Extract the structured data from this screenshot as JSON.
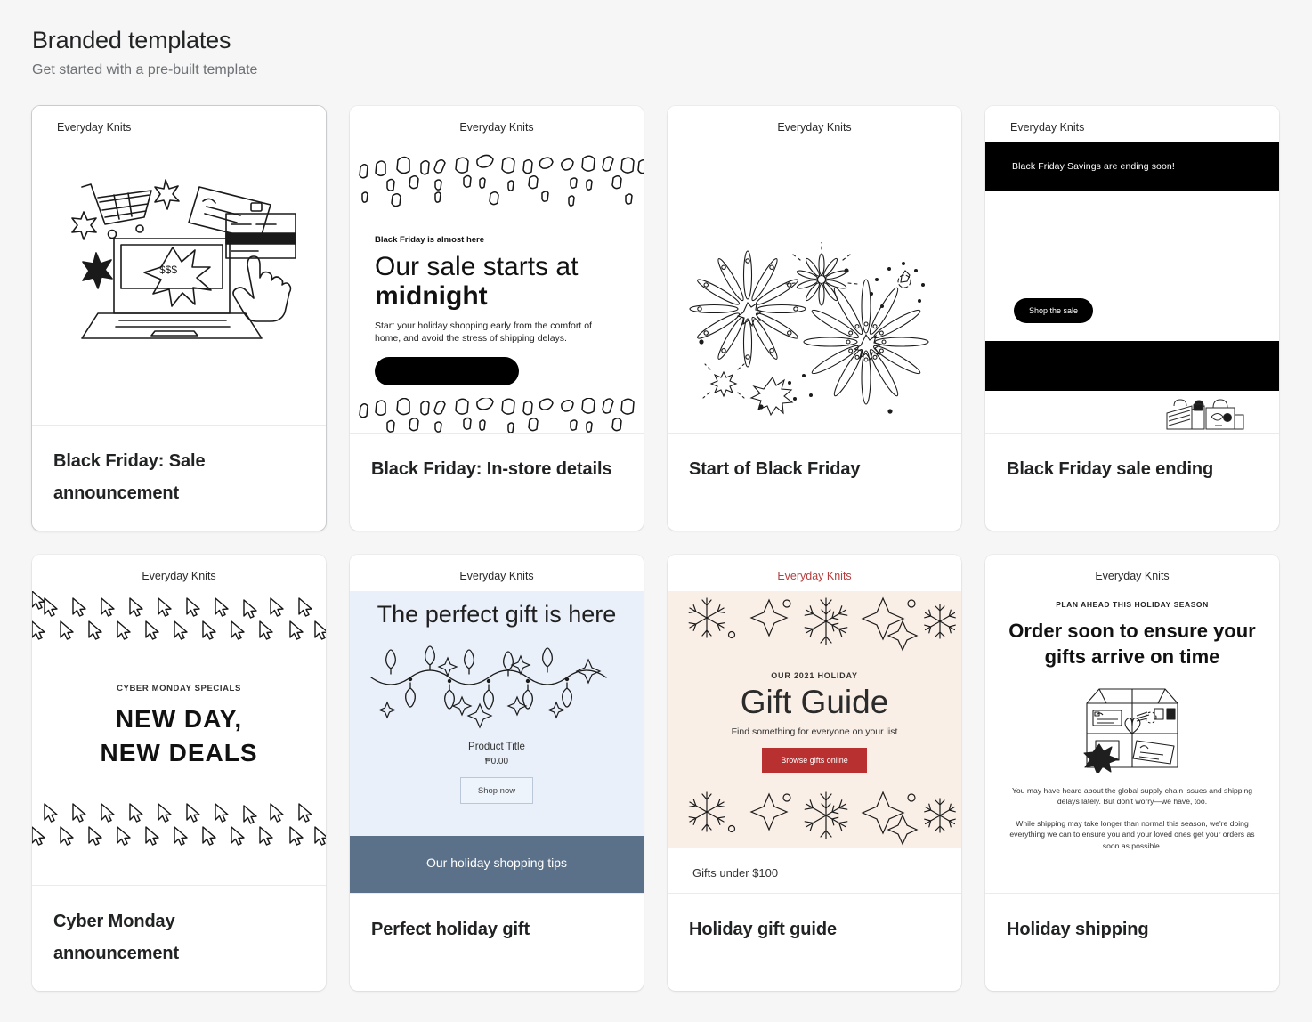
{
  "header": {
    "title": "Branded templates",
    "subtitle": "Get started with a pre-built template"
  },
  "brand_name": "Everyday Knits",
  "accent_colors": {
    "page_background": "#f6f6f6",
    "card_background": "#ffffff",
    "title_text": "#202223",
    "subtitle_text": "#6d7175",
    "gift_guide_cream": "#faefe7",
    "gift_guide_red": "#b93030",
    "gift_guide_brand_red": "#b34040",
    "perfect_gift_blue": "#e9f0fa",
    "perfect_gift_slate": "#5b7189",
    "black": "#000000"
  },
  "cards": [
    {
      "id": "black-friday-sale-announcement",
      "brand": "Everyday Knits",
      "title": "Black Friday: Sale announcement",
      "illustration": "laptop-shopping-illustration",
      "selected": true
    },
    {
      "id": "black-friday-in-store-details",
      "brand": "Everyday Knits",
      "title": "Black Friday: In-store details",
      "eyebrow": "Black Friday is almost here",
      "heading_line1": "Our sale starts at",
      "heading_line2": "midnight",
      "body": "Start your holiday shopping early from the comfort of home, and avoid the stress of shipping delays.",
      "button_label": "",
      "illustration": "confetti-border"
    },
    {
      "id": "start-of-black-friday",
      "brand": "Everyday Knits",
      "title": "Start of Black Friday",
      "illustration": "fireworks-illustration"
    },
    {
      "id": "black-friday-sale-ending",
      "brand": "Everyday Knits",
      "title": "Black Friday sale ending",
      "banner": "Black Friday Savings are ending soon!",
      "button_label": "Shop the sale",
      "illustration": "shopping-bags-illustration"
    },
    {
      "id": "cyber-monday-announcement",
      "brand": "Everyday Knits",
      "title": "Cyber Monday announcement",
      "eyebrow": "CYBER MONDAY SPECIALS",
      "heading_line1": "NEW  DAY,",
      "heading_line2": "NEW  DEALS",
      "illustration": "cursor-arrow-border"
    },
    {
      "id": "perfect-holiday-gift",
      "brand": "Everyday Knits",
      "title": "Perfect holiday gift",
      "heading": "The perfect gift is here",
      "product_title": "Product Title",
      "product_price": "₱0.00",
      "button_label": "Shop now",
      "tips_label": "Our holiday shopping tips",
      "illustration": "string-lights-illustration"
    },
    {
      "id": "holiday-gift-guide",
      "brand": "Everyday Knits",
      "title": "Holiday gift guide",
      "eyebrow": "OUR 2021 HOLIDAY",
      "heading": "Gift Guide",
      "subheading": "Find something for everyone on your list",
      "button_label": "Browse gifts online",
      "section_label": "Gifts under $100",
      "illustration": "snowflakes-border"
    },
    {
      "id": "holiday-shipping",
      "brand": "Everyday Knits",
      "title": "Holiday shipping",
      "eyebrow": "PLAN AHEAD THIS HOLIDAY SEASON",
      "heading": "Order soon to ensure your gifts arrive on time",
      "body_1": "You may have heard about the global supply chain issues and shipping delays lately. But don't worry—we have, too.",
      "body_2": "While shipping may take longer than normal this season, we're doing everything we can to ensure you and your loved ones get your orders as soon as possible.",
      "illustration": "parcel-box-illustration"
    }
  ]
}
